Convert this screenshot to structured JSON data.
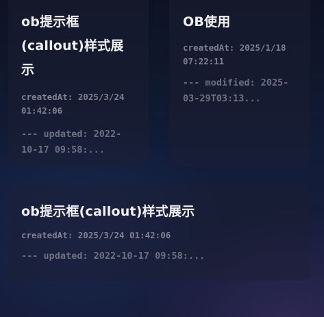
{
  "cards": [
    {
      "title": "ob提示框(callout)样式展示",
      "created": "createdAt: 2025/3/24 01:42:06",
      "excerpt": "--- updated: 2022-10-17 09:58:..."
    },
    {
      "title": "OB使用",
      "created": "createdAt: 2025/1/18 07:22:11",
      "excerpt": "--- modified: 2025-03-29T03:13..."
    },
    {
      "title": "ob提示框(callout)样式展示",
      "created": "createdAt: 2025/3/24 01:42:06",
      "excerpt": "--- updated: 2022-10-17 09:58:..."
    }
  ],
  "colors": {
    "title": "#f2f2f4",
    "meta": "#7f8190",
    "excerpt": "#6e7080",
    "background": "#131d3a"
  }
}
